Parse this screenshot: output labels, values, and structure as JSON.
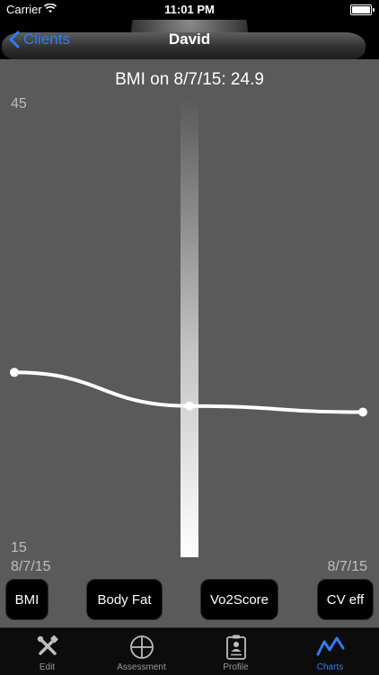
{
  "status_bar": {
    "carrier": "Carrier",
    "time": "11:01 PM"
  },
  "nav": {
    "back_label": "Clients",
    "title": "David"
  },
  "chart_data": {
    "type": "line",
    "title": "BMI on 8/7/15: 24.9",
    "ylim": [
      15,
      45
    ],
    "y_ticks": [
      "45",
      "15"
    ],
    "x_labels": [
      "8/7/15",
      "8/7/15"
    ],
    "series": [
      {
        "values": [
          27.1,
          24.9,
          24.5
        ]
      }
    ],
    "selected_index": 1,
    "grid": false,
    "line_color": "#ffffff",
    "background": "#5a5a5a"
  },
  "metric_buttons": [
    {
      "label": "BMI"
    },
    {
      "label": "Body Fat"
    },
    {
      "label": "Vo2Score"
    },
    {
      "label": "CV eff"
    }
  ],
  "tabs": [
    {
      "label": "Edit",
      "icon": "tools-icon"
    },
    {
      "label": "Assessment",
      "icon": "plus-circle-icon"
    },
    {
      "label": "Profile",
      "icon": "profile-card-icon"
    },
    {
      "label": "Charts",
      "icon": "chart-line-icon",
      "active": true
    }
  ],
  "colors": {
    "accent": "#2f7cf6"
  }
}
